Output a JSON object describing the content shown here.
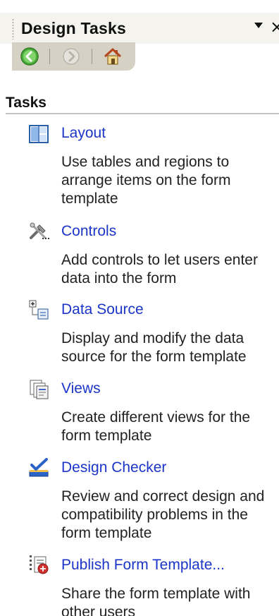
{
  "pane": {
    "title": "Design Tasks",
    "close_label": "×",
    "section_header": "Tasks"
  },
  "tasks": [
    {
      "label": "Layout",
      "icon": "layout-icon",
      "description": "Use tables and regions to arrange items on the form template"
    },
    {
      "label": "Controls",
      "icon": "controls-icon",
      "description": "Add controls to let users enter data into the form"
    },
    {
      "label": "Data Source",
      "icon": "data-source-icon",
      "description": "Display and modify the data source for the form template"
    },
    {
      "label": "Views",
      "icon": "views-icon",
      "description": "Create different views for the form template"
    },
    {
      "label": "Design Checker",
      "icon": "design-checker-icon",
      "description": "Review and correct design and compatibility problems in the form template"
    },
    {
      "label": "Publish Form Template...",
      "icon": "publish-icon",
      "description": "Share the form template with other users"
    }
  ],
  "colors": {
    "link": "#1b35c8",
    "toolbar": "#d5d2c5",
    "titlebar": "#f4f3ee"
  }
}
